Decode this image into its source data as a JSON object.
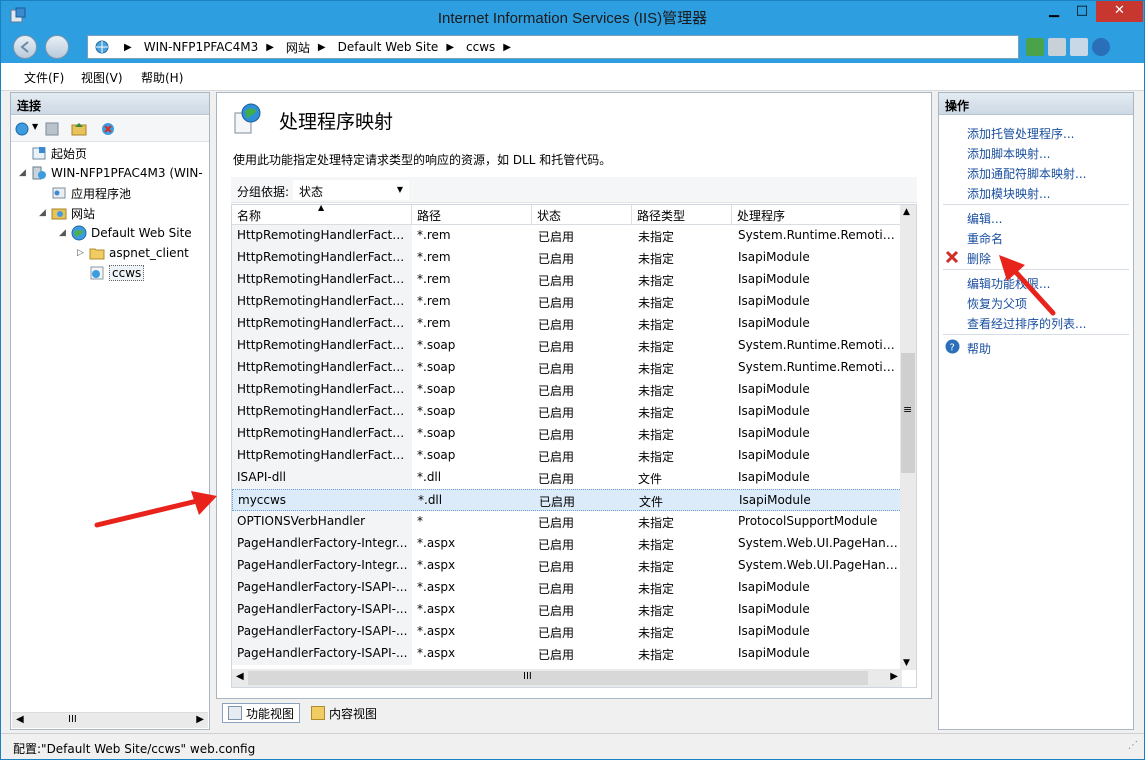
{
  "window": {
    "title": "Internet Information Services (IIS)管理器",
    "minimize": "▁",
    "maximize": "□",
    "close": "✕"
  },
  "address": {
    "crumbs": [
      "WIN-NFP1PFAC4M3",
      "网站",
      "Default Web Site",
      "ccws"
    ]
  },
  "menu": [
    "文件(F)",
    "视图(V)",
    "帮助(H)"
  ],
  "connections": {
    "header": "连接",
    "tree": [
      {
        "label": "起始页",
        "icon": "start-page-icon",
        "level": 0
      },
      {
        "label": "WIN-NFP1PFAC4M3 (WIN-",
        "icon": "server-icon",
        "level": 0
      },
      {
        "label": "应用程序池",
        "icon": "app-pool-icon",
        "level": 1
      },
      {
        "label": "网站",
        "icon": "sites-folder-icon",
        "level": 1
      },
      {
        "label": "Default Web Site",
        "icon": "globe-icon",
        "level": 2
      },
      {
        "label": "aspnet_client",
        "icon": "folder-icon",
        "level": 3
      },
      {
        "label": "ccws",
        "icon": "application-icon",
        "level": 3,
        "selected": true
      }
    ]
  },
  "feature": {
    "title": "处理程序映射",
    "description": "使用此功能指定处理特定请求类型的响应的资源，如 DLL 和托管代码。",
    "group_label": "分组依据:",
    "group_value": "状态"
  },
  "grid": {
    "columns": [
      "名称",
      "路径",
      "状态",
      "路径类型",
      "处理程序"
    ],
    "rows": [
      [
        "HttpRemotingHandlerFacto...",
        "*.rem",
        "已启用",
        "未指定",
        "System.Runtime.Remoting...."
      ],
      [
        "HttpRemotingHandlerFacto...",
        "*.rem",
        "已启用",
        "未指定",
        "IsapiModule"
      ],
      [
        "HttpRemotingHandlerFacto...",
        "*.rem",
        "已启用",
        "未指定",
        "IsapiModule"
      ],
      [
        "HttpRemotingHandlerFacto...",
        "*.rem",
        "已启用",
        "未指定",
        "IsapiModule"
      ],
      [
        "HttpRemotingHandlerFacto...",
        "*.rem",
        "已启用",
        "未指定",
        "IsapiModule"
      ],
      [
        "HttpRemotingHandlerFacto...",
        "*.soap",
        "已启用",
        "未指定",
        "System.Runtime.Remoting...."
      ],
      [
        "HttpRemotingHandlerFacto...",
        "*.soap",
        "已启用",
        "未指定",
        "System.Runtime.Remoting...."
      ],
      [
        "HttpRemotingHandlerFacto...",
        "*.soap",
        "已启用",
        "未指定",
        "IsapiModule"
      ],
      [
        "HttpRemotingHandlerFacto...",
        "*.soap",
        "已启用",
        "未指定",
        "IsapiModule"
      ],
      [
        "HttpRemotingHandlerFacto...",
        "*.soap",
        "已启用",
        "未指定",
        "IsapiModule"
      ],
      [
        "HttpRemotingHandlerFacto...",
        "*.soap",
        "已启用",
        "未指定",
        "IsapiModule"
      ],
      [
        "ISAPI-dll",
        "*.dll",
        "已启用",
        "文件",
        "IsapiModule"
      ],
      [
        "myccws",
        "*.dll",
        "已启用",
        "文件",
        "IsapiModule"
      ],
      [
        "OPTIONSVerbHandler",
        "*",
        "已启用",
        "未指定",
        "ProtocolSupportModule"
      ],
      [
        "PageHandlerFactory-Integr...",
        "*.aspx",
        "已启用",
        "未指定",
        "System.Web.UI.PageHandl..."
      ],
      [
        "PageHandlerFactory-Integr...",
        "*.aspx",
        "已启用",
        "未指定",
        "System.Web.UI.PageHandl..."
      ],
      [
        "PageHandlerFactory-ISAPI-...",
        "*.aspx",
        "已启用",
        "未指定",
        "IsapiModule"
      ],
      [
        "PageHandlerFactory-ISAPI-...",
        "*.aspx",
        "已启用",
        "未指定",
        "IsapiModule"
      ],
      [
        "PageHandlerFactory-ISAPI-...",
        "*.aspx",
        "已启用",
        "未指定",
        "IsapiModule"
      ],
      [
        "PageHandlerFactory-ISAPI-...",
        "*.aspx",
        "已启用",
        "未指定",
        "IsapiModule"
      ]
    ],
    "selected_row": 12,
    "hscroll_glyph": "III",
    "vscroll_glyph": "≡"
  },
  "view_tabs": [
    "功能视图",
    "内容视图"
  ],
  "actions": {
    "header": "操作",
    "group1": [
      "添加托管处理程序...",
      "添加脚本映射...",
      "添加通配符脚本映射...",
      "添加模块映射..."
    ],
    "group2": [
      "编辑...",
      "重命名",
      "删除"
    ],
    "group3": [
      "编辑功能权限...",
      "恢复为父项",
      "查看经过排序的列表..."
    ],
    "help": "帮助"
  },
  "status": "配置:\"Default Web Site/ccws\" web.config",
  "colors": {
    "title_bar": "#2d9ee0",
    "link": "#1a4fa0",
    "delete_x": "#d0302a",
    "arrow": "#e8231b",
    "selected_row": "#dcebfa"
  }
}
